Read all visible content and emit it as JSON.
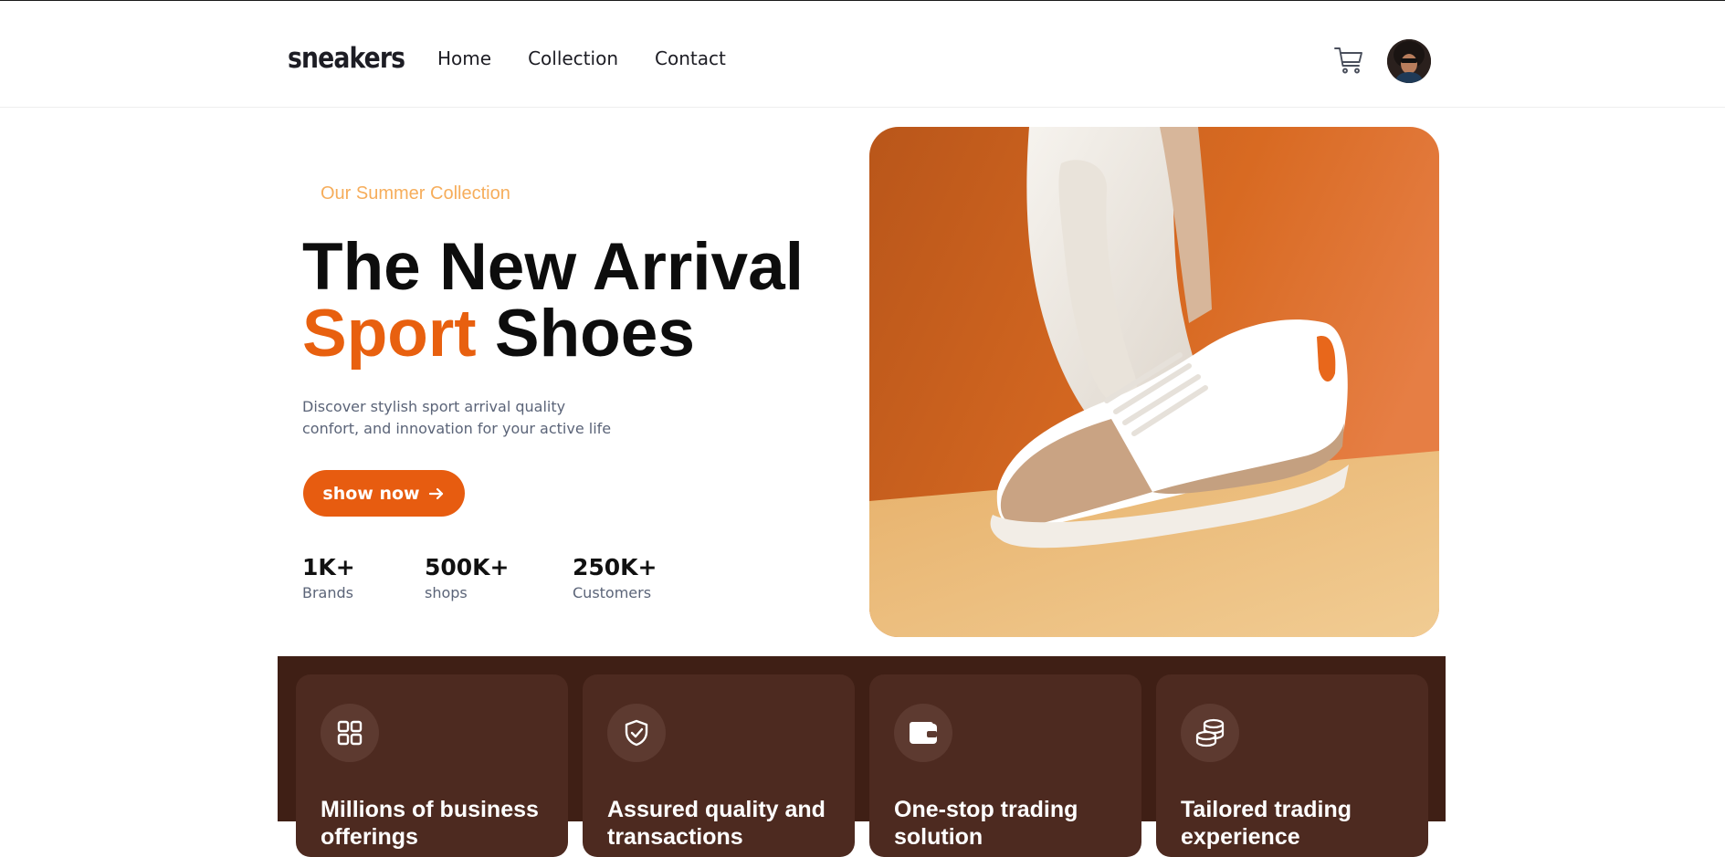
{
  "header": {
    "logo": "sneakers",
    "nav": [
      "Home",
      "Collection",
      "Contact"
    ],
    "icons": [
      "cart-icon",
      "avatar"
    ]
  },
  "hero": {
    "eyebrow": "Our Summer Collection",
    "title_line1": "The New Arrival",
    "title_accent": "Sport",
    "title_rest": "Shoes",
    "description_line1": "Discover stylish sport arrival quality",
    "description_line2": "confort, and innovation for your active life",
    "cta": "show now",
    "stats": [
      {
        "value": "1K+",
        "label": "Brands"
      },
      {
        "value": "500K+",
        "label": "shops"
      },
      {
        "value": "250K+",
        "label": "Customers"
      }
    ]
  },
  "features": [
    {
      "icon": "grid-icon",
      "title": "Millions of business offerings"
    },
    {
      "icon": "shield-check-icon",
      "title": "Assured quality and transactions"
    },
    {
      "icon": "wallet-icon",
      "title": "One-stop trading solution"
    },
    {
      "icon": "coins-icon",
      "title": "Tailored trading experience"
    }
  ],
  "colors": {
    "accent": "#e75c10",
    "eyebrow": "#f6ad5b",
    "band": "#3f1f15",
    "card": "#4d2a20"
  }
}
